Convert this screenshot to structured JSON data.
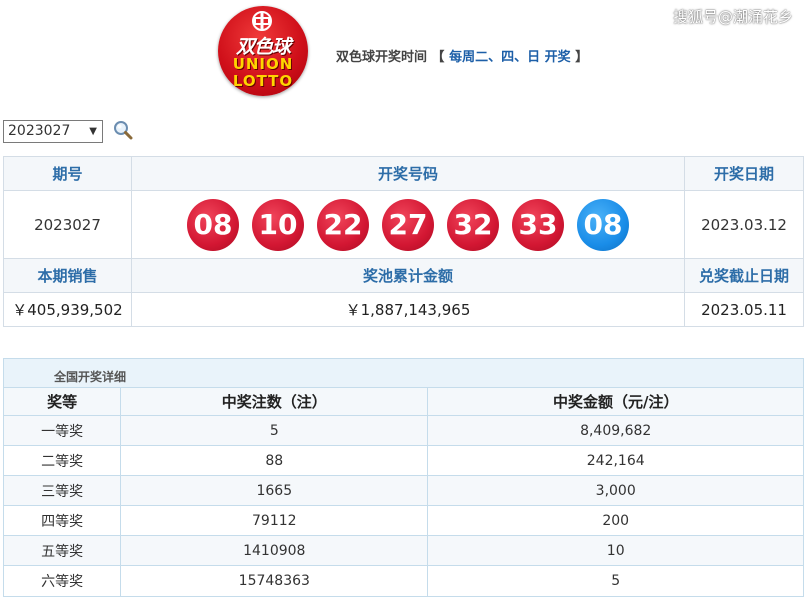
{
  "watermark": "搜狐号@潮涌花乡",
  "logo": {
    "cn": "双色球",
    "en_line1": "UNION",
    "en_line2": "LOTTO",
    "colors": {
      "bg": "#d0101a",
      "text_cn": "#ffffff",
      "text_en": "#ffd400"
    }
  },
  "draw_time": {
    "label": "双色球开奖时间",
    "open_bracket": "【",
    "days": "每周二、四、日 开奖",
    "close_bracket": "】"
  },
  "issue_select": {
    "value": "2023027",
    "arrow": "▼"
  },
  "search": {
    "icon": "magnifier-icon"
  },
  "result": {
    "headers": {
      "issue": "期号",
      "numbers": "开奖号码",
      "date": "开奖日期"
    },
    "issue": "2023027",
    "red_balls": [
      "08",
      "10",
      "22",
      "27",
      "32",
      "33"
    ],
    "blue_ball": "08",
    "date": "2023.03.12",
    "headers2": {
      "sales": "本期销售",
      "pool": "奖池累计金额",
      "deadline": "兑奖截止日期"
    },
    "sales": "￥405,939,502",
    "pool": "￥1,887,143,965",
    "deadline": "2023.05.11",
    "colors": {
      "header_text": "#2d6da8",
      "red": "#d31733",
      "blue": "#1a8de8"
    }
  },
  "detail": {
    "title": "全国开奖详细",
    "columns": [
      "奖等",
      "中奖注数（注）",
      "中奖金额（元/注）"
    ],
    "rows": [
      {
        "level": "一等奖",
        "count": "5",
        "amount": "8,409,682"
      },
      {
        "level": "二等奖",
        "count": "88",
        "amount": "242,164"
      },
      {
        "level": "三等奖",
        "count": "1665",
        "amount": "3,000"
      },
      {
        "level": "四等奖",
        "count": "79112",
        "amount": "200"
      },
      {
        "level": "五等奖",
        "count": "1410908",
        "amount": "10"
      },
      {
        "level": "六等奖",
        "count": "15748363",
        "amount": "5"
      }
    ]
  }
}
